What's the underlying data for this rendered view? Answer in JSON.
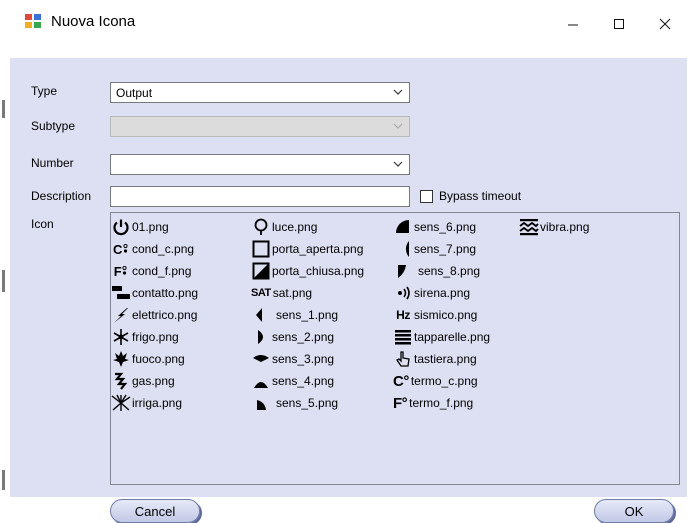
{
  "window": {
    "title": "Nuova Icona"
  },
  "form": {
    "type_label": "Type",
    "type_value": "Output",
    "subtype_label": "Subtype",
    "subtype_value": "",
    "number_label": "Number",
    "number_value": "",
    "description_label": "Description",
    "description_value": "",
    "bypass_label": "Bypass timeout",
    "bypass_checked": false,
    "icon_label": "Icon"
  },
  "icons": [
    {
      "name": "01.png",
      "icon": "power-icon"
    },
    {
      "name": "cond_c.png",
      "icon": "cond-c-icon"
    },
    {
      "name": "cond_f.png",
      "icon": "cond-f-icon"
    },
    {
      "name": "contatto.png",
      "icon": "contatto-icon"
    },
    {
      "name": "elettrico.png",
      "icon": "lightning-icon"
    },
    {
      "name": "frigo.png",
      "icon": "snowflake-icon"
    },
    {
      "name": "fuoco.png",
      "icon": "fire-icon"
    },
    {
      "name": "gas.png",
      "icon": "gas-icon"
    },
    {
      "name": "irriga.png",
      "icon": "irrigation-icon"
    },
    {
      "name": "luce.png",
      "icon": "bulb-icon"
    },
    {
      "name": "porta_aperta.png",
      "icon": "door-open-icon"
    },
    {
      "name": "porta_chiusa.png",
      "icon": "door-closed-icon"
    },
    {
      "name": "sat.png",
      "icon": "sat-icon"
    },
    {
      "name": "sens_1.png",
      "icon": "sensor-1-icon"
    },
    {
      "name": "sens_2.png",
      "icon": "sensor-2-icon"
    },
    {
      "name": "sens_3.png",
      "icon": "sensor-3-icon"
    },
    {
      "name": "sens_4.png",
      "icon": "sensor-4-icon"
    },
    {
      "name": "sens_5.png",
      "icon": "sensor-5-icon"
    },
    {
      "name": "sens_6.png",
      "icon": "sensor-6-icon"
    },
    {
      "name": "sens_7.png",
      "icon": "sensor-7-icon"
    },
    {
      "name": "sens_8.png",
      "icon": "sensor-8-icon"
    },
    {
      "name": "sirena.png",
      "icon": "siren-icon"
    },
    {
      "name": "sismico.png",
      "icon": "seismic-icon"
    },
    {
      "name": "tapparelle.png",
      "icon": "shutter-icon"
    },
    {
      "name": "tastiera.png",
      "icon": "hand-pointer-icon"
    },
    {
      "name": "termo_c.png",
      "icon": "thermo-c-icon"
    },
    {
      "name": "termo_f.png",
      "icon": "thermo-f-icon"
    },
    {
      "name": "vibra.png",
      "icon": "vibration-icon"
    }
  ],
  "icon_glyph_text": {
    "cond_c": "C",
    "cond_f": "F",
    "sat": "SAT",
    "sismico": "Hz",
    "termo_c": "C°",
    "termo_f": "F°"
  },
  "buttons": {
    "cancel": "Cancel",
    "ok": "OK"
  },
  "colors": {
    "client_bg": "#dde0f2",
    "button_face": "#c2c8e6"
  }
}
